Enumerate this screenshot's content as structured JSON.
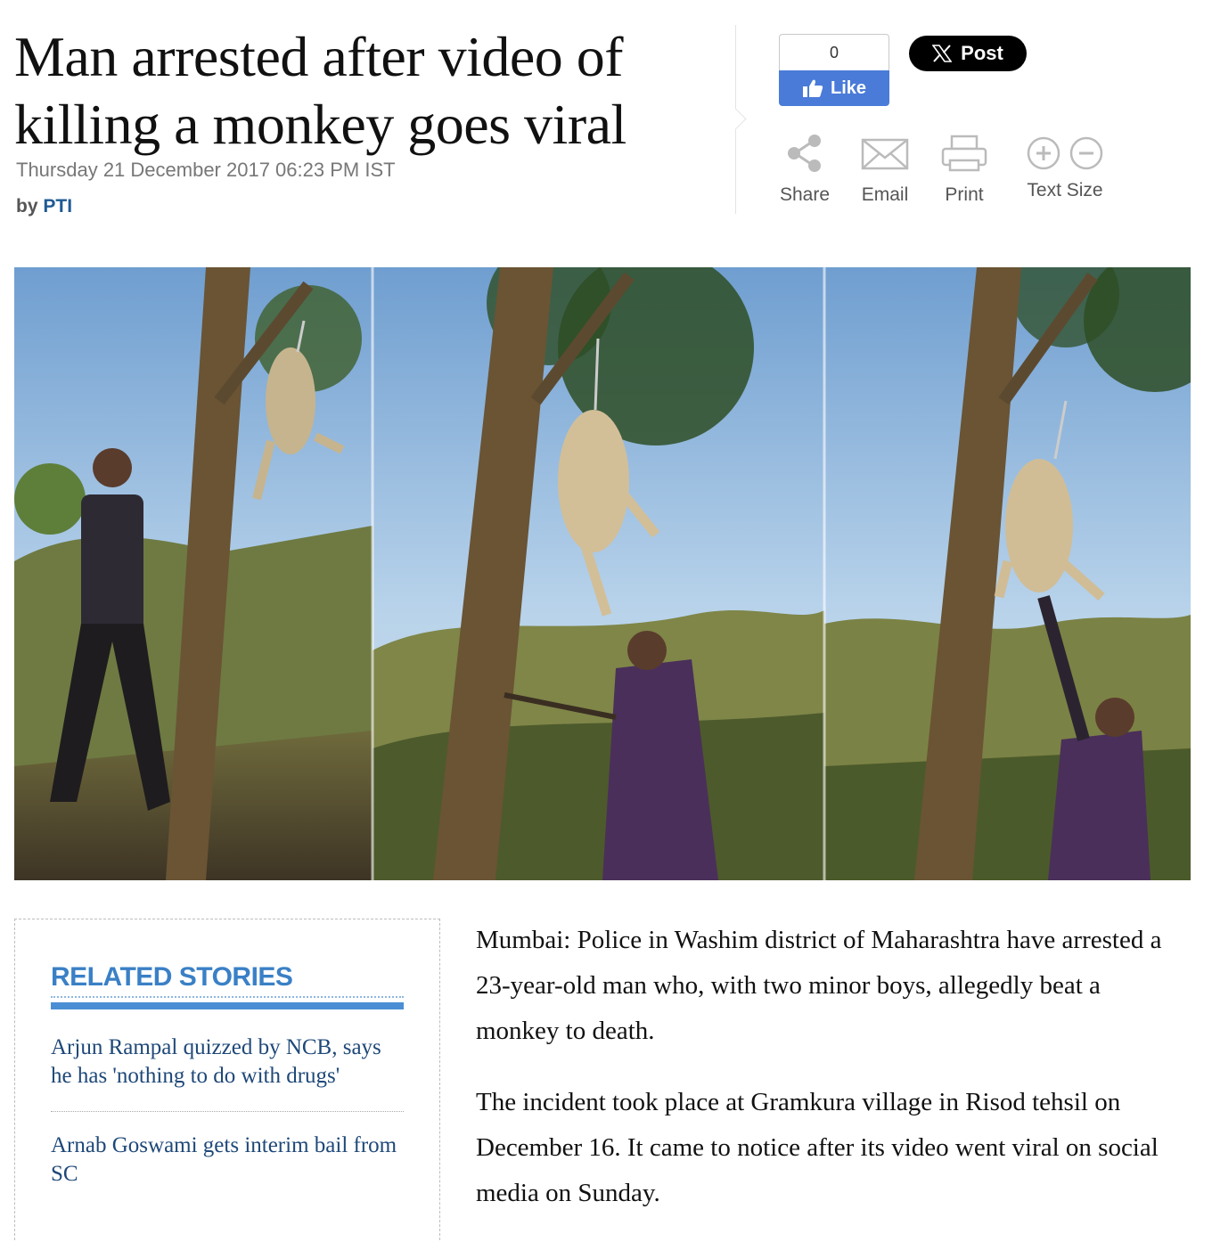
{
  "article": {
    "headline": "Man arrested after video of killing a monkey goes viral",
    "dateline": "Thursday 21 December 2017 06:23 PM IST",
    "byline_prefix": "by",
    "author": "PTI",
    "paragraphs": [
      "Mumbai: Police in Washim district of Maharashtra have arrested a 23-year-old man who, with two minor boys, allegedly beat a monkey to death.",
      "The incident took place at Gramkura village in Risod tehsil on December 16. It came to notice after its video went viral on social media on Sunday."
    ]
  },
  "social": {
    "fb_count": "0",
    "fb_like_label": "Like",
    "x_post_label": "Post"
  },
  "tools": {
    "share": "Share",
    "email": "Email",
    "print": "Print",
    "text_size": "Text Size"
  },
  "related": {
    "title": "RELATED STORIES",
    "items": [
      "Arjun Rampal quizzed by NCB, says he has 'nothing to do with drugs'",
      "Arnab Goswami gets interim bail from SC"
    ]
  },
  "colors": {
    "fb_blue": "#4a7bd8",
    "related_blue": "#3a80c6",
    "link_navy": "#1e4878",
    "author_blue": "#1f5a94"
  },
  "icons": [
    "thumbs-up-icon",
    "x-logo-icon",
    "share-icon",
    "email-icon",
    "print-icon",
    "text-increase-icon",
    "text-decrease-icon"
  ]
}
